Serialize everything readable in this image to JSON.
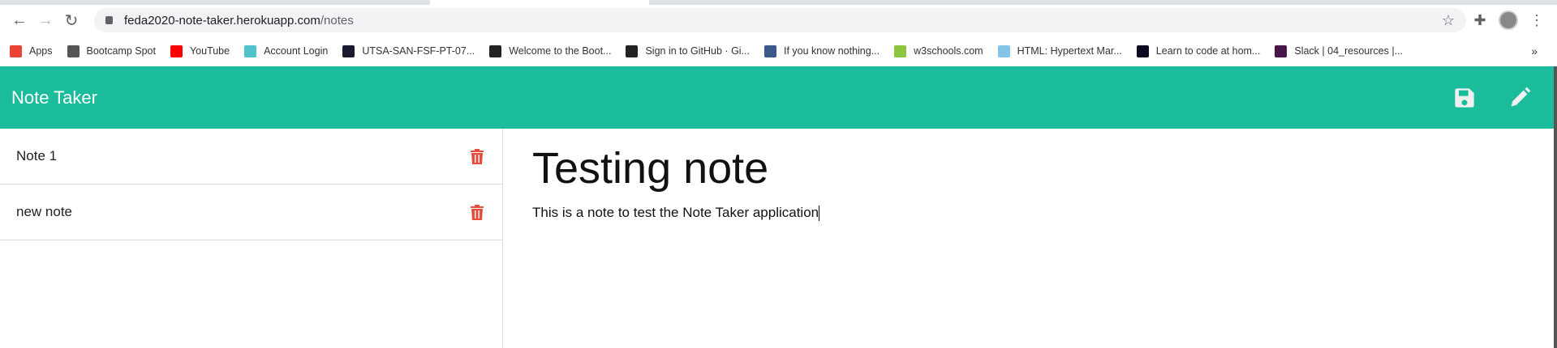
{
  "browser": {
    "url_host": "feda2020-note-taker.herokuapp.com",
    "url_path": "/notes",
    "bookmarks": [
      {
        "label": "Apps",
        "color": "#ea4335"
      },
      {
        "label": "Bootcamp Spot",
        "color": "#555"
      },
      {
        "label": "YouTube",
        "color": "#ff0000"
      },
      {
        "label": "Account Login",
        "color": "#4fc3c9"
      },
      {
        "label": "UTSA-SAN-FSF-PT-07...",
        "color": "#1a1a2e"
      },
      {
        "label": "Welcome to the Boot...",
        "color": "#222"
      },
      {
        "label": "Sign in to GitHub · Gi...",
        "color": "#222"
      },
      {
        "label": "If you know nothing...",
        "color": "#3b5a8c"
      },
      {
        "label": "w3schools.com",
        "color": "#8cc63f"
      },
      {
        "label": "HTML: Hypertext Mar...",
        "color": "#83c5e8"
      },
      {
        "label": "Learn to code at hom...",
        "color": "#0a0a23"
      },
      {
        "label": "Slack | 04_resources |...",
        "color": "#4a154b"
      }
    ],
    "more": "»"
  },
  "app": {
    "brand": "Note Taker",
    "accent": "#1abc9c",
    "delete_color": "#e74c3c",
    "notes": [
      {
        "title": "Note 1"
      },
      {
        "title": "new note"
      }
    ],
    "active": {
      "title": "Testing note",
      "text": "This is a note to test the Note Taker application"
    }
  }
}
